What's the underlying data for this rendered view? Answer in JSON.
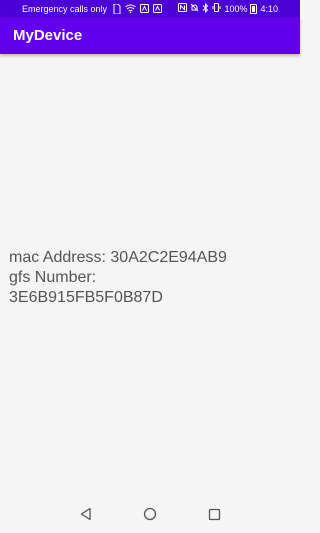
{
  "status_bar": {
    "carrier_text": "Emergency calls only",
    "battery_percent": "100%",
    "time": "4:10"
  },
  "app_bar": {
    "title": "MyDevice"
  },
  "content": {
    "mac_label": "mac Address:",
    "mac_value": "30A2C2E94AB9",
    "gfs_label": "gfs Number:",
    "gfs_value": "3E6B915FB5F0B87D"
  },
  "icons": {
    "status": [
      "sim-icon",
      "wifi-icon",
      "notification-icon",
      "notification-icon",
      "nfc-icon",
      "silent-icon",
      "bluetooth-icon",
      "vibrate-icon",
      "battery-icon"
    ],
    "nav": [
      "back-icon",
      "home-icon",
      "recents-icon"
    ]
  },
  "colors": {
    "status_bar": "#4a00d6",
    "app_bar": "#6200ee",
    "background": "#f5f5f5",
    "text": "#555555"
  }
}
